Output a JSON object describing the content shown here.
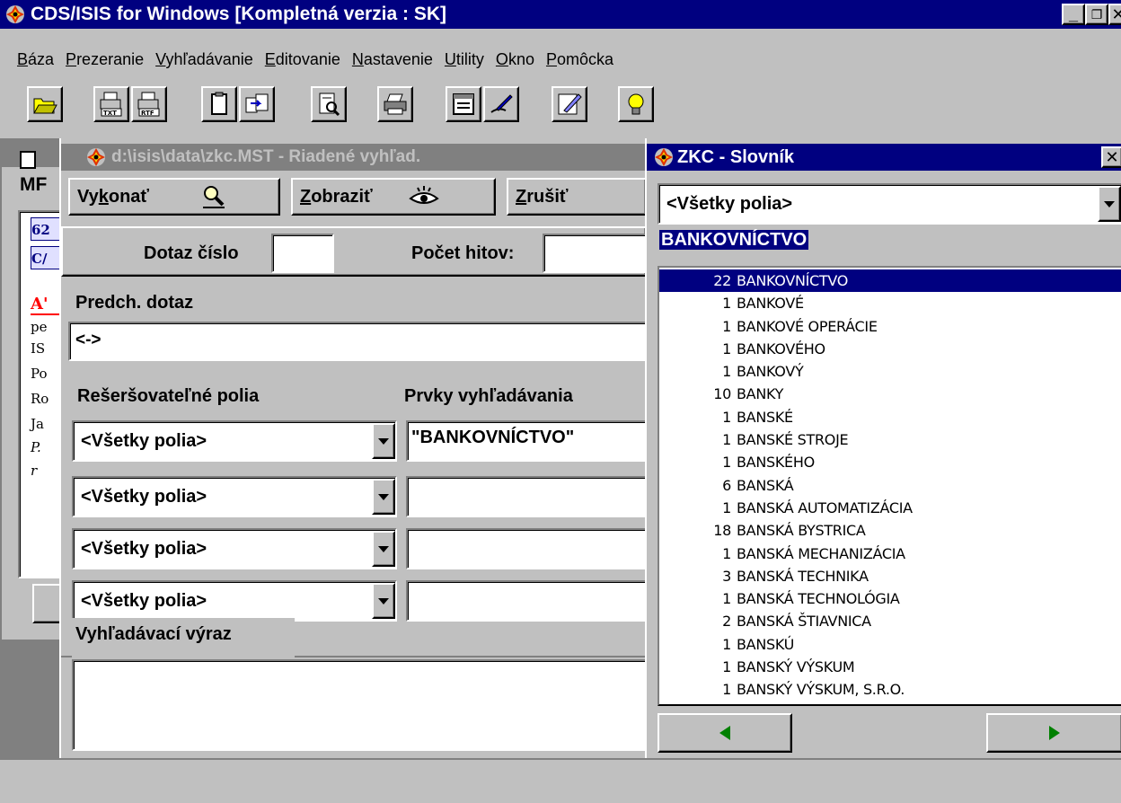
{
  "app": {
    "title": "CDS/ISIS for Windows [Kompletná verzia : SK]",
    "menu": [
      "Báza",
      "Prezeranie",
      "Vyhľadávanie",
      "Editovanie",
      "Nastavenie",
      "Utility",
      "Okno",
      "Pomôcka"
    ],
    "toolbar_icons": [
      "open-folder-icon",
      "print-txt-icon",
      "print-rtf-icon",
      "clipboard-icon",
      "copy-record-icon",
      "preview-icon",
      "printer-icon",
      "form-icon",
      "edit-pen-icon",
      "notepad-icon",
      "lightbulb-icon"
    ]
  },
  "background_window": {
    "label": "MF",
    "record_lines": [
      "62",
      "C/",
      "A'",
      "pe",
      "IS",
      "Po",
      "Ro",
      "Ja",
      "P.",
      "r"
    ]
  },
  "search_window": {
    "title": "d:\\isis\\data\\zkc.MST - Riadené vyhľad.",
    "buttons": {
      "execute": {
        "before": "Vy",
        "underline": "k",
        "after": "onať"
      },
      "show": {
        "before": "",
        "underline": "Z",
        "after": "obraziť"
      },
      "cancel": {
        "before": "",
        "underline": "Z",
        "after": "rušiť"
      }
    },
    "query_number_label": "Dotaz číslo",
    "query_number_value": "",
    "hits_label": "Počet hitov:",
    "hits_value": "",
    "prev_query_label": "Predch. dotaz",
    "prev_query_value": "<->",
    "searchable_fields_label": "Rešeršovateľné polia",
    "search_terms_label": "Prvky vyhľadávania",
    "rows": [
      {
        "field": "<Všetky polia>",
        "term": "\"BANKOVNÍCTVO\""
      },
      {
        "field": "<Všetky polia>",
        "term": ""
      },
      {
        "field": "<Všetky polia>",
        "term": ""
      },
      {
        "field": "<Všetky polia>",
        "term": ""
      }
    ],
    "expression_label": "Vyhľadávací výraz",
    "expression_value": ""
  },
  "dictionary_window": {
    "title": "ZKC - Slovník",
    "field_select": "<Všetky polia>",
    "current_term": "BANKOVNÍCTVO",
    "entries": [
      {
        "count": "22",
        "term": "BANKOVNÍCTVO",
        "selected": true
      },
      {
        "count": "1",
        "term": "BANKOVÉ"
      },
      {
        "count": "1",
        "term": "BANKOVÉ OPERÁCIE"
      },
      {
        "count": "1",
        "term": "BANKOVÉHO"
      },
      {
        "count": "1",
        "term": "BANKOVÝ"
      },
      {
        "count": "10",
        "term": "BANKY"
      },
      {
        "count": "1",
        "term": "BANSKÉ"
      },
      {
        "count": "1",
        "term": "BANSKÉ STROJE"
      },
      {
        "count": "1",
        "term": "BANSKÉHO"
      },
      {
        "count": "6",
        "term": "BANSKÁ"
      },
      {
        "count": "1",
        "term": "BANSKÁ AUTOMATIZÁCIA"
      },
      {
        "count": "18",
        "term": "BANSKÁ BYSTRICA"
      },
      {
        "count": "1",
        "term": "BANSKÁ MECHANIZÁCIA"
      },
      {
        "count": "3",
        "term": "BANSKÁ TECHNIKA"
      },
      {
        "count": "1",
        "term": "BANSKÁ TECHNOLÓGIA"
      },
      {
        "count": "2",
        "term": "BANSKÁ ŠTIAVNICA"
      },
      {
        "count": "1",
        "term": "BANSKÚ"
      },
      {
        "count": "1",
        "term": "BANSKÝ VÝSKUM"
      },
      {
        "count": "1",
        "term": "BANSKÝ VÝSKUM, S.R.O."
      }
    ],
    "nav": [
      "prev-arrow-icon",
      "next-arrow-icon"
    ]
  },
  "colors": {
    "title_active": "#000080",
    "title_inactive": "#808080",
    "face": "#c0c0c0",
    "arrow_green": "#008000",
    "record_red": "#ff0000"
  }
}
